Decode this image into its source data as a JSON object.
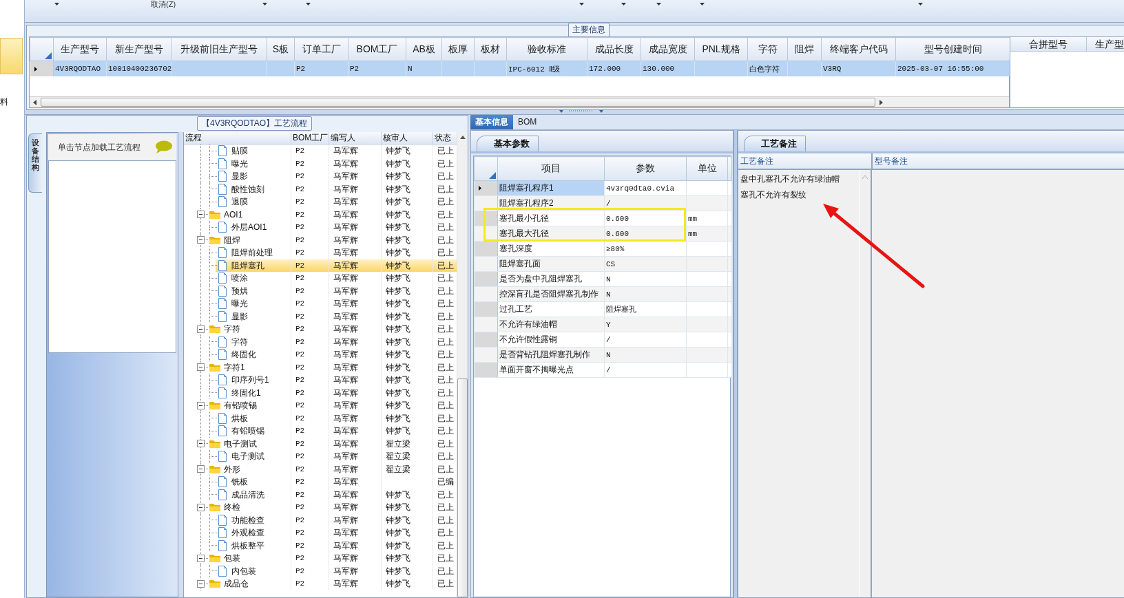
{
  "nav": {
    "items": [
      {
        "selected": true
      },
      {
        "label": "料",
        "selected": false
      }
    ]
  },
  "toolbar": {
    "cancel": "取消(Z)"
  },
  "main_info": {
    "title": "主要信息",
    "columns": [
      "生产型号",
      "新生产型号",
      "升级前旧生产型号",
      "S板",
      "订单工厂",
      "BOM工厂",
      "AB板",
      "板厚",
      "板材",
      "验收标准",
      "成品长度",
      "成品宽度",
      "PNL规格",
      "字符",
      "阻焊",
      "终端客户代码",
      "型号创建时间"
    ],
    "rows": [
      {
        "selected": true,
        "cells": [
          "4V3RQODTAO",
          "10010400236702",
          null,
          null,
          "P2",
          "P2",
          "N",
          null,
          null,
          "IPC-6012 Ⅱ级",
          "172.000",
          "130.000",
          null,
          "白色字符",
          null,
          "V3RQ",
          "2025-03-07 16:55:00"
        ]
      }
    ]
  },
  "merge_grid": {
    "columns": [
      "合拼型号",
      "生产型"
    ]
  },
  "process_flow": {
    "title": "【4V3RQODTAO】工艺流程",
    "side_tab": "设备结构",
    "hint": "单击节点加载工艺流程",
    "columns": [
      "流程",
      "BOM工厂",
      "编写人",
      "核审人",
      "状态"
    ],
    "tree": [
      {
        "kind": "folder",
        "expanded": true,
        "children": [
          {
            "label": "贴膜",
            "kind": "file",
            "bom": "P2",
            "writer": "马军辉",
            "reviewer": "钟梦飞",
            "status": "已上",
            "selected": false
          },
          {
            "label": "曝光",
            "kind": "file",
            "bom": "P2",
            "writer": "马军辉",
            "reviewer": "钟梦飞",
            "status": "已上",
            "selected": false
          },
          {
            "label": "显影",
            "kind": "file",
            "bom": "P2",
            "writer": "马军辉",
            "reviewer": "钟梦飞",
            "status": "已上",
            "selected": false
          },
          {
            "label": "酸性蚀刻",
            "kind": "file",
            "bom": "P2",
            "writer": "马军辉",
            "reviewer": "钟梦飞",
            "status": "已上",
            "selected": false
          },
          {
            "label": "退膜",
            "kind": "file",
            "bom": "P2",
            "writer": "马军辉",
            "reviewer": "钟梦飞",
            "status": "已上",
            "selected": false
          }
        ]
      },
      {
        "label": "AOI1",
        "kind": "folder",
        "expanded": true,
        "bom": "P2",
        "writer": "马军辉",
        "reviewer": "钟梦飞",
        "status": "已上",
        "selected": false,
        "children": [
          {
            "label": "外层AOI1",
            "kind": "file",
            "bom": "P2",
            "writer": "马军辉",
            "reviewer": "钟梦飞",
            "status": "已上",
            "selected": false
          }
        ]
      },
      {
        "label": "阻焊",
        "kind": "folder",
        "expanded": true,
        "bom": "P2",
        "writer": "马军辉",
        "reviewer": "钟梦飞",
        "status": "已上",
        "selected": false,
        "children": [
          {
            "label": "阻焊前处理",
            "kind": "file",
            "bom": "P2",
            "writer": "马军辉",
            "reviewer": "钟梦飞",
            "status": "已上",
            "selected": false
          },
          {
            "label": "阻焊塞孔",
            "kind": "file",
            "bom": "P2",
            "writer": "马军辉",
            "reviewer": "钟梦飞",
            "status": "已上",
            "selected": true
          },
          {
            "label": "喷涂",
            "kind": "file",
            "bom": "P2",
            "writer": "马军辉",
            "reviewer": "钟梦飞",
            "status": "已上",
            "selected": false
          },
          {
            "label": "预烘",
            "kind": "file",
            "bom": "P2",
            "writer": "马军辉",
            "reviewer": "钟梦飞",
            "status": "已上",
            "selected": false
          },
          {
            "label": "曝光",
            "kind": "file",
            "bom": "P2",
            "writer": "马军辉",
            "reviewer": "钟梦飞",
            "status": "已上",
            "selected": false
          },
          {
            "label": "显影",
            "kind": "file",
            "bom": "P2",
            "writer": "马军辉",
            "reviewer": "钟梦飞",
            "status": "已上",
            "selected": false
          }
        ]
      },
      {
        "label": "字符",
        "kind": "folder",
        "expanded": true,
        "bom": "P2",
        "writer": "马军辉",
        "reviewer": "钟梦飞",
        "status": "已上",
        "selected": false,
        "children": [
          {
            "label": "字符",
            "kind": "file",
            "bom": "P2",
            "writer": "马军辉",
            "reviewer": "钟梦飞",
            "status": "已上",
            "selected": false
          },
          {
            "label": "终固化",
            "kind": "file",
            "bom": "P2",
            "writer": "马军辉",
            "reviewer": "钟梦飞",
            "status": "已上",
            "selected": false
          }
        ]
      },
      {
        "label": "字符1",
        "kind": "folder",
        "expanded": true,
        "bom": "P2",
        "writer": "马军辉",
        "reviewer": "钟梦飞",
        "status": "已上",
        "selected": false,
        "children": [
          {
            "label": "印序列号1",
            "kind": "file",
            "bom": "P2",
            "writer": "马军辉",
            "reviewer": "钟梦飞",
            "status": "已上",
            "selected": false
          },
          {
            "label": "终固化1",
            "kind": "file",
            "bom": "P2",
            "writer": "马军辉",
            "reviewer": "钟梦飞",
            "status": "已上",
            "selected": false
          }
        ]
      },
      {
        "label": "有铅喷锡",
        "kind": "folder",
        "expanded": true,
        "bom": "P2",
        "writer": "马军辉",
        "reviewer": "钟梦飞",
        "status": "已上",
        "selected": false,
        "children": [
          {
            "label": "烘板",
            "kind": "file",
            "bom": "P2",
            "writer": "马军辉",
            "reviewer": "钟梦飞",
            "status": "已上",
            "selected": false
          },
          {
            "label": "有铅喷锡",
            "kind": "file",
            "bom": "P2",
            "writer": "马军辉",
            "reviewer": "钟梦飞",
            "status": "已上",
            "selected": false
          }
        ]
      },
      {
        "label": "电子测试",
        "kind": "folder",
        "expanded": true,
        "bom": "P2",
        "writer": "马军辉",
        "reviewer": "翟立梁",
        "status": "已上",
        "selected": false,
        "children": [
          {
            "label": "电子测试",
            "kind": "file",
            "bom": "P2",
            "writer": "马军辉",
            "reviewer": "翟立梁",
            "status": "已上",
            "selected": false
          }
        ]
      },
      {
        "label": "外形",
        "kind": "folder",
        "expanded": true,
        "bom": "P2",
        "writer": "马军辉",
        "reviewer": "翟立梁",
        "status": "已上",
        "selected": false,
        "children": [
          {
            "label": "铣板",
            "kind": "file",
            "bom": "P2",
            "writer": "马军辉",
            "status": "已编",
            "selected": false
          },
          {
            "label": "成品清洗",
            "kind": "file",
            "bom": "P2",
            "writer": "马军辉",
            "reviewer": "钟梦飞",
            "status": "已上",
            "selected": false
          }
        ]
      },
      {
        "label": "终检",
        "kind": "folder",
        "expanded": true,
        "bom": "P2",
        "writer": "马军辉",
        "reviewer": "钟梦飞",
        "status": "已上",
        "selected": false,
        "children": [
          {
            "label": "功能检查",
            "kind": "file",
            "bom": "P2",
            "writer": "马军辉",
            "reviewer": "钟梦飞",
            "status": "已上",
            "selected": false
          },
          {
            "label": "外观检查",
            "kind": "file",
            "bom": "P2",
            "writer": "马军辉",
            "reviewer": "钟梦飞",
            "status": "已上",
            "selected": false
          },
          {
            "label": "烘板整平",
            "kind": "file",
            "bom": "P2",
            "writer": "马军辉",
            "reviewer": "钟梦飞",
            "status": "已上",
            "selected": false
          }
        ]
      },
      {
        "label": "包装",
        "kind": "folder",
        "expanded": true,
        "bom": "P2",
        "writer": "马军辉",
        "reviewer": "钟梦飞",
        "status": "已上",
        "selected": false,
        "children": [
          {
            "label": "内包装",
            "kind": "file",
            "bom": "P2",
            "writer": "马军辉",
            "reviewer": "钟梦飞",
            "status": "已上",
            "selected": false
          }
        ]
      },
      {
        "label": "成品仓",
        "kind": "folder",
        "expanded": true,
        "bom": "P2",
        "writer": "马军辉",
        "reviewer": "钟梦飞",
        "status": "已上",
        "selected": false
      }
    ]
  },
  "detail": {
    "tabs": [
      {
        "label": "基本信息",
        "selected": true
      },
      {
        "label": "BOM",
        "selected": false
      }
    ],
    "params": {
      "tab": "基本参数",
      "columns": [
        "项目",
        "参数",
        "单位"
      ],
      "rows": [
        {
          "item": "阻焊塞孔程序1",
          "value": "4v3rq0dta0.cvia",
          "selected": true
        },
        {
          "item": "阻焊塞孔程序2",
          "value": "/",
          "selected": false
        },
        {
          "item": "塞孔最小孔径",
          "value": "0.600",
          "unit": "mm",
          "selected": false
        },
        {
          "item": "塞孔最大孔径",
          "value": "0.600",
          "unit": "mm",
          "selected": false
        },
        {
          "item": "塞孔深度",
          "value": "≥80%",
          "selected": false
        },
        {
          "item": "阻焊塞孔面",
          "value": "CS",
          "selected": false
        },
        {
          "item": "是否为盘中孔阻焊塞孔",
          "value": "N",
          "selected": false
        },
        {
          "item": "控深盲孔是否阻焊塞孔制作",
          "value": "N",
          "selected": false
        },
        {
          "item": "过孔工艺",
          "value": "阻焊塞孔",
          "selected": false
        },
        {
          "item": "不允许有绿油帽",
          "value": "Y",
          "selected": false
        },
        {
          "item": "不允许假性露铜",
          "value": "/",
          "selected": false
        },
        {
          "item": "是否背钻孔阻焊塞孔制作",
          "value": "N",
          "selected": false
        },
        {
          "item": "单面开窗不掏曝光点",
          "value": "/",
          "selected": false
        }
      ]
    },
    "notes": {
      "tab": "工艺备注",
      "columns": [
        "工艺备注",
        "型号备注"
      ],
      "process_notes": [
        "盘中孔塞孔不允许有绿油帽",
        "塞孔不允许有裂纹"
      ]
    }
  }
}
